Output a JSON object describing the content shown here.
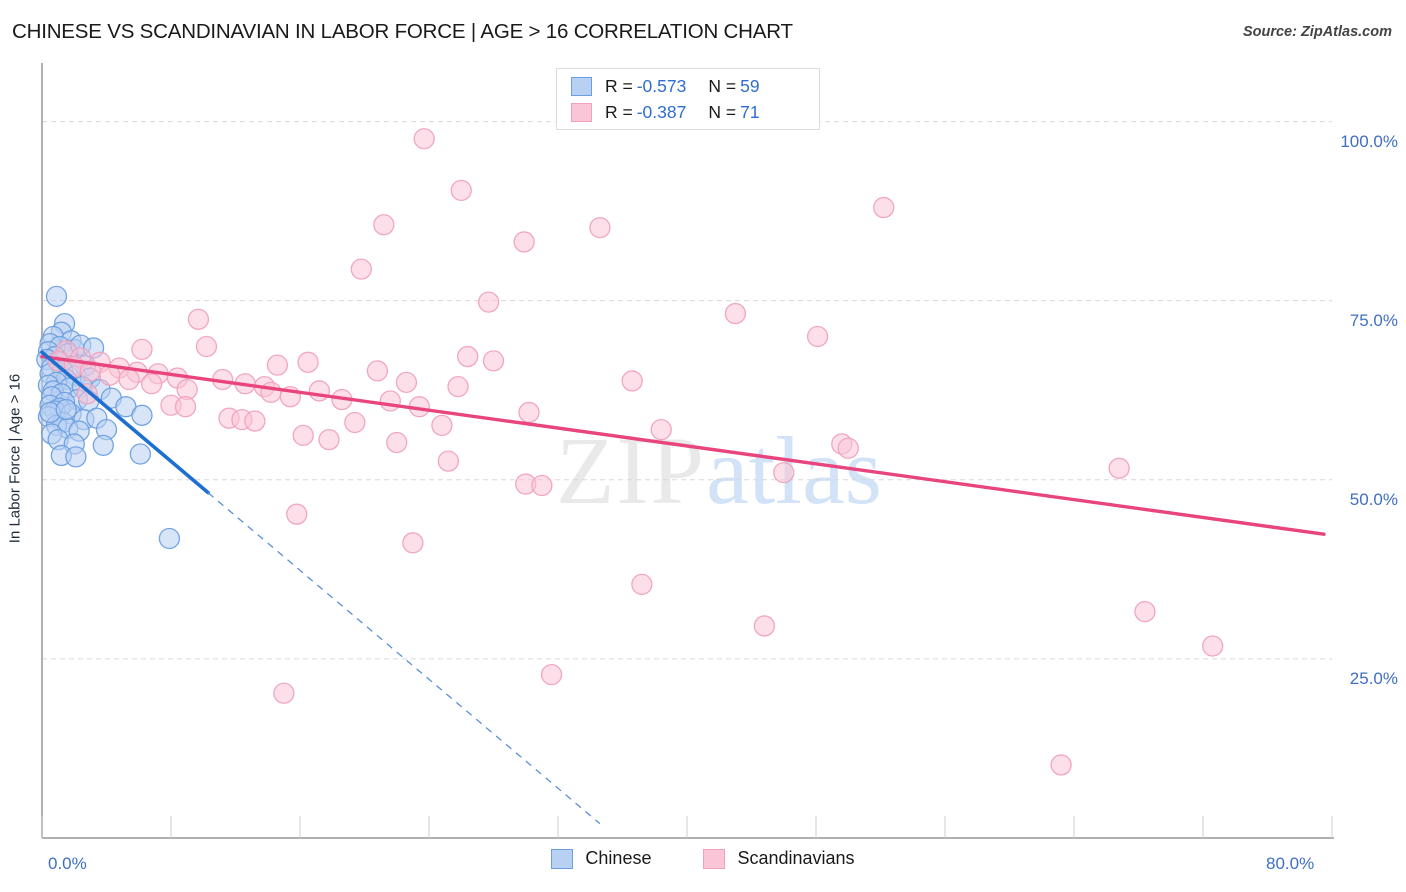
{
  "header": {
    "title": "CHINESE VS SCANDINAVIAN IN LABOR FORCE | AGE > 16 CORRELATION CHART",
    "source": "Source: ZipAtlas.com"
  },
  "watermark": {
    "part1": "ZIP",
    "part2": "atlas"
  },
  "stats_legend": {
    "rows": [
      {
        "series": "Chinese",
        "color": "#b8d0f2",
        "r_label": "R =",
        "r_value": "-0.573",
        "n_label": "N =",
        "n_value": "59"
      },
      {
        "series": "Scandinavians",
        "color": "#fac5d6",
        "r_label": "R =",
        "r_value": "-0.387",
        "n_label": "N =",
        "n_value": "71"
      }
    ]
  },
  "bottom_legend": {
    "items": [
      {
        "label": "Chinese",
        "color": "#b8d0f2"
      },
      {
        "label": "Scandinavians",
        "color": "#fac5d6"
      }
    ]
  },
  "chart_data": {
    "type": "scatter",
    "title": "CHINESE VS SCANDINAVIAN IN LABOR FORCE | AGE > 16 CORRELATION CHART",
    "xlabel": "",
    "ylabel": "In Labor Force | Age > 16",
    "xlim": [
      0,
      80
    ],
    "ylim": [
      0,
      106.5
    ],
    "grid": true,
    "legend_position": "bottom-center",
    "xticks": [
      {
        "value": 0,
        "label": "0.0%"
      },
      {
        "value": 80,
        "label": "80.0%"
      }
    ],
    "yticks": [
      {
        "value": 25,
        "label": "25.0%"
      },
      {
        "value": 50,
        "label": "50.0%"
      },
      {
        "value": 75,
        "label": "75.0%"
      },
      {
        "value": 100,
        "label": "100.0%"
      }
    ],
    "series": [
      {
        "name": "Chinese",
        "color": "#b8d0f2",
        "edge_color": "#6d9fe0",
        "r": -0.573,
        "n": 59,
        "trendline": {
          "x0": 0.0,
          "y0": 67.8,
          "x1": 10.3,
          "y1": 48.2,
          "solid": true
        },
        "trendline_dashed": {
          "x0": 10.3,
          "y0": 48.2,
          "x1": 34.6,
          "y1": 2.0
        },
        "points": [
          [
            0.9,
            75.6
          ],
          [
            1.4,
            71.8
          ],
          [
            1.2,
            70.6
          ],
          [
            0.7,
            70.0
          ],
          [
            1.8,
            69.4
          ],
          [
            0.5,
            69.0
          ],
          [
            1.1,
            68.6
          ],
          [
            2.0,
            68.2
          ],
          [
            0.4,
            67.9
          ],
          [
            1.6,
            67.6
          ],
          [
            0.8,
            67.2
          ],
          [
            2.4,
            68.8
          ],
          [
            3.2,
            68.4
          ],
          [
            0.3,
            66.8
          ],
          [
            1.0,
            66.4
          ],
          [
            1.9,
            66.0
          ],
          [
            0.6,
            65.6
          ],
          [
            2.7,
            65.9
          ],
          [
            1.3,
            65.2
          ],
          [
            0.5,
            64.8
          ],
          [
            2.1,
            64.5
          ],
          [
            1.5,
            64.0
          ],
          [
            0.9,
            63.6
          ],
          [
            3.0,
            64.2
          ],
          [
            0.4,
            63.2
          ],
          [
            1.7,
            62.8
          ],
          [
            2.5,
            63.0
          ],
          [
            0.7,
            62.4
          ],
          [
            1.2,
            62.0
          ],
          [
            3.6,
            62.6
          ],
          [
            0.6,
            61.6
          ],
          [
            2.2,
            61.2
          ],
          [
            1.4,
            60.8
          ],
          [
            0.5,
            60.4
          ],
          [
            2.9,
            61.0
          ],
          [
            1.1,
            60.0
          ],
          [
            4.3,
            61.4
          ],
          [
            0.8,
            59.6
          ],
          [
            1.8,
            59.2
          ],
          [
            5.2,
            60.2
          ],
          [
            0.4,
            58.8
          ],
          [
            2.6,
            58.4
          ],
          [
            1.3,
            58.0
          ],
          [
            3.4,
            58.6
          ],
          [
            0.9,
            57.6
          ],
          [
            6.2,
            59.0
          ],
          [
            1.6,
            57.2
          ],
          [
            2.3,
            56.8
          ],
          [
            0.6,
            56.4
          ],
          [
            4.0,
            57.0
          ],
          [
            1.0,
            55.6
          ],
          [
            0.5,
            59.4
          ],
          [
            1.5,
            59.8
          ],
          [
            2.0,
            55.0
          ],
          [
            3.8,
            54.8
          ],
          [
            1.2,
            53.4
          ],
          [
            2.1,
            53.2
          ],
          [
            6.1,
            53.6
          ],
          [
            7.9,
            41.8
          ]
        ]
      },
      {
        "name": "Scandinavians",
        "color": "#fac5d6",
        "edge_color": "#f0a2bd",
        "r": -0.387,
        "n": 71,
        "trendline": {
          "x0": 0.0,
          "y0": 67.2,
          "x1": 79.5,
          "y1": 42.4,
          "solid": true
        },
        "points": [
          [
            23.7,
            97.6
          ],
          [
            26.0,
            90.4
          ],
          [
            21.2,
            85.6
          ],
          [
            52.2,
            88.0
          ],
          [
            34.6,
            85.2
          ],
          [
            29.9,
            83.2
          ],
          [
            19.8,
            79.4
          ],
          [
            27.7,
            74.8
          ],
          [
            43.0,
            73.2
          ],
          [
            48.1,
            70.0
          ],
          [
            9.7,
            72.4
          ],
          [
            6.2,
            68.2
          ],
          [
            10.2,
            68.6
          ],
          [
            26.4,
            67.2
          ],
          [
            28.0,
            66.6
          ],
          [
            14.6,
            66.0
          ],
          [
            16.5,
            66.4
          ],
          [
            1.5,
            68.0
          ],
          [
            2.4,
            67.0
          ],
          [
            3.6,
            66.4
          ],
          [
            4.8,
            65.6
          ],
          [
            5.9,
            65.0
          ],
          [
            7.2,
            64.8
          ],
          [
            8.4,
            64.2
          ],
          [
            11.2,
            64.0
          ],
          [
            12.6,
            63.4
          ],
          [
            13.8,
            63.0
          ],
          [
            20.8,
            65.2
          ],
          [
            22.6,
            63.6
          ],
          [
            25.8,
            63.0
          ],
          [
            36.6,
            63.8
          ],
          [
            1.0,
            66.6
          ],
          [
            2.0,
            65.8
          ],
          [
            3.0,
            65.2
          ],
          [
            4.2,
            64.6
          ],
          [
            5.4,
            64.0
          ],
          [
            6.8,
            63.4
          ],
          [
            9.0,
            62.6
          ],
          [
            14.2,
            62.2
          ],
          [
            15.4,
            61.6
          ],
          [
            17.2,
            62.4
          ],
          [
            18.6,
            61.2
          ],
          [
            21.6,
            61.0
          ],
          [
            23.4,
            60.2
          ],
          [
            30.2,
            59.4
          ],
          [
            8.0,
            60.4
          ],
          [
            8.9,
            60.2
          ],
          [
            11.6,
            58.6
          ],
          [
            12.4,
            58.4
          ],
          [
            13.2,
            58.2
          ],
          [
            19.4,
            58.0
          ],
          [
            24.8,
            57.6
          ],
          [
            38.4,
            57.0
          ],
          [
            49.6,
            55.0
          ],
          [
            2.8,
            62.0
          ],
          [
            16.2,
            56.2
          ],
          [
            17.8,
            55.6
          ],
          [
            22.0,
            55.2
          ],
          [
            25.2,
            52.6
          ],
          [
            30.0,
            49.4
          ],
          [
            31.0,
            49.2
          ],
          [
            46.0,
            51.0
          ],
          [
            50.0,
            54.4
          ],
          [
            66.8,
            51.6
          ],
          [
            15.8,
            45.2
          ],
          [
            23.0,
            41.2
          ],
          [
            37.2,
            35.4
          ],
          [
            68.4,
            31.6
          ],
          [
            44.8,
            29.6
          ],
          [
            72.6,
            26.8
          ],
          [
            15.0,
            20.2
          ],
          [
            31.6,
            22.8
          ],
          [
            63.2,
            10.2
          ]
        ]
      }
    ]
  }
}
